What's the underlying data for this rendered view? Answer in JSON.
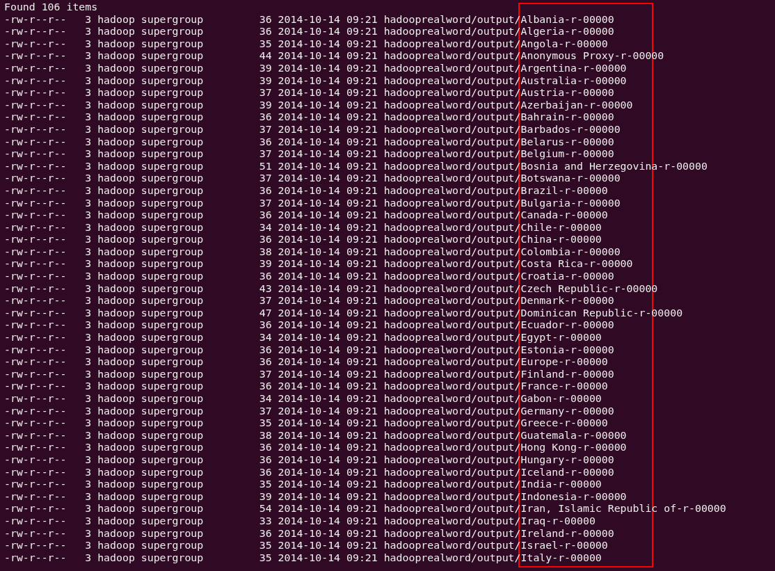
{
  "terminal": {
    "header_line": "Found 106 items",
    "entries": [
      {
        "permissions": "-rw-r--r--",
        "replication": "3",
        "owner": "hadoop",
        "group": "supergroup",
        "size": "36",
        "date": "2014-10-14",
        "time": "09:21",
        "directory": "hadooprealword/output/",
        "file": "Albania-r-00000"
      },
      {
        "permissions": "-rw-r--r--",
        "replication": "3",
        "owner": "hadoop",
        "group": "supergroup",
        "size": "36",
        "date": "2014-10-14",
        "time": "09:21",
        "directory": "hadooprealword/output/",
        "file": "Algeria-r-00000"
      },
      {
        "permissions": "-rw-r--r--",
        "replication": "3",
        "owner": "hadoop",
        "group": "supergroup",
        "size": "35",
        "date": "2014-10-14",
        "time": "09:21",
        "directory": "hadooprealword/output/",
        "file": "Angola-r-00000"
      },
      {
        "permissions": "-rw-r--r--",
        "replication": "3",
        "owner": "hadoop",
        "group": "supergroup",
        "size": "44",
        "date": "2014-10-14",
        "time": "09:21",
        "directory": "hadooprealword/output/",
        "file": "Anonymous Proxy-r-00000"
      },
      {
        "permissions": "-rw-r--r--",
        "replication": "3",
        "owner": "hadoop",
        "group": "supergroup",
        "size": "39",
        "date": "2014-10-14",
        "time": "09:21",
        "directory": "hadooprealword/output/",
        "file": "Argentina-r-00000"
      },
      {
        "permissions": "-rw-r--r--",
        "replication": "3",
        "owner": "hadoop",
        "group": "supergroup",
        "size": "39",
        "date": "2014-10-14",
        "time": "09:21",
        "directory": "hadooprealword/output/",
        "file": "Australia-r-00000"
      },
      {
        "permissions": "-rw-r--r--",
        "replication": "3",
        "owner": "hadoop",
        "group": "supergroup",
        "size": "37",
        "date": "2014-10-14",
        "time": "09:21",
        "directory": "hadooprealword/output/",
        "file": "Austria-r-00000"
      },
      {
        "permissions": "-rw-r--r--",
        "replication": "3",
        "owner": "hadoop",
        "group": "supergroup",
        "size": "39",
        "date": "2014-10-14",
        "time": "09:21",
        "directory": "hadooprealword/output/",
        "file": "Azerbaijan-r-00000"
      },
      {
        "permissions": "-rw-r--r--",
        "replication": "3",
        "owner": "hadoop",
        "group": "supergroup",
        "size": "36",
        "date": "2014-10-14",
        "time": "09:21",
        "directory": "hadooprealword/output/",
        "file": "Bahrain-r-00000"
      },
      {
        "permissions": "-rw-r--r--",
        "replication": "3",
        "owner": "hadoop",
        "group": "supergroup",
        "size": "37",
        "date": "2014-10-14",
        "time": "09:21",
        "directory": "hadooprealword/output/",
        "file": "Barbados-r-00000"
      },
      {
        "permissions": "-rw-r--r--",
        "replication": "3",
        "owner": "hadoop",
        "group": "supergroup",
        "size": "36",
        "date": "2014-10-14",
        "time": "09:21",
        "directory": "hadooprealword/output/",
        "file": "Belarus-r-00000"
      },
      {
        "permissions": "-rw-r--r--",
        "replication": "3",
        "owner": "hadoop",
        "group": "supergroup",
        "size": "37",
        "date": "2014-10-14",
        "time": "09:21",
        "directory": "hadooprealword/output/",
        "file": "Belgium-r-00000"
      },
      {
        "permissions": "-rw-r--r--",
        "replication": "3",
        "owner": "hadoop",
        "group": "supergroup",
        "size": "51",
        "date": "2014-10-14",
        "time": "09:21",
        "directory": "hadooprealword/output/",
        "file": "Bosnia and Herzegovina-r-00000"
      },
      {
        "permissions": "-rw-r--r--",
        "replication": "3",
        "owner": "hadoop",
        "group": "supergroup",
        "size": "37",
        "date": "2014-10-14",
        "time": "09:21",
        "directory": "hadooprealword/output/",
        "file": "Botswana-r-00000"
      },
      {
        "permissions": "-rw-r--r--",
        "replication": "3",
        "owner": "hadoop",
        "group": "supergroup",
        "size": "36",
        "date": "2014-10-14",
        "time": "09:21",
        "directory": "hadooprealword/output/",
        "file": "Brazil-r-00000"
      },
      {
        "permissions": "-rw-r--r--",
        "replication": "3",
        "owner": "hadoop",
        "group": "supergroup",
        "size": "37",
        "date": "2014-10-14",
        "time": "09:21",
        "directory": "hadooprealword/output/",
        "file": "Bulgaria-r-00000"
      },
      {
        "permissions": "-rw-r--r--",
        "replication": "3",
        "owner": "hadoop",
        "group": "supergroup",
        "size": "36",
        "date": "2014-10-14",
        "time": "09:21",
        "directory": "hadooprealword/output/",
        "file": "Canada-r-00000"
      },
      {
        "permissions": "-rw-r--r--",
        "replication": "3",
        "owner": "hadoop",
        "group": "supergroup",
        "size": "34",
        "date": "2014-10-14",
        "time": "09:21",
        "directory": "hadooprealword/output/",
        "file": "Chile-r-00000"
      },
      {
        "permissions": "-rw-r--r--",
        "replication": "3",
        "owner": "hadoop",
        "group": "supergroup",
        "size": "36",
        "date": "2014-10-14",
        "time": "09:21",
        "directory": "hadooprealword/output/",
        "file": "China-r-00000"
      },
      {
        "permissions": "-rw-r--r--",
        "replication": "3",
        "owner": "hadoop",
        "group": "supergroup",
        "size": "38",
        "date": "2014-10-14",
        "time": "09:21",
        "directory": "hadooprealword/output/",
        "file": "Colombia-r-00000"
      },
      {
        "permissions": "-rw-r--r--",
        "replication": "3",
        "owner": "hadoop",
        "group": "supergroup",
        "size": "39",
        "date": "2014-10-14",
        "time": "09:21",
        "directory": "hadooprealword/output/",
        "file": "Costa Rica-r-00000"
      },
      {
        "permissions": "-rw-r--r--",
        "replication": "3",
        "owner": "hadoop",
        "group": "supergroup",
        "size": "36",
        "date": "2014-10-14",
        "time": "09:21",
        "directory": "hadooprealword/output/",
        "file": "Croatia-r-00000"
      },
      {
        "permissions": "-rw-r--r--",
        "replication": "3",
        "owner": "hadoop",
        "group": "supergroup",
        "size": "43",
        "date": "2014-10-14",
        "time": "09:21",
        "directory": "hadooprealword/output/",
        "file": "Czech Republic-r-00000"
      },
      {
        "permissions": "-rw-r--r--",
        "replication": "3",
        "owner": "hadoop",
        "group": "supergroup",
        "size": "37",
        "date": "2014-10-14",
        "time": "09:21",
        "directory": "hadooprealword/output/",
        "file": "Denmark-r-00000"
      },
      {
        "permissions": "-rw-r--r--",
        "replication": "3",
        "owner": "hadoop",
        "group": "supergroup",
        "size": "47",
        "date": "2014-10-14",
        "time": "09:21",
        "directory": "hadooprealword/output/",
        "file": "Dominican Republic-r-00000"
      },
      {
        "permissions": "-rw-r--r--",
        "replication": "3",
        "owner": "hadoop",
        "group": "supergroup",
        "size": "36",
        "date": "2014-10-14",
        "time": "09:21",
        "directory": "hadooprealword/output/",
        "file": "Ecuador-r-00000"
      },
      {
        "permissions": "-rw-r--r--",
        "replication": "3",
        "owner": "hadoop",
        "group": "supergroup",
        "size": "34",
        "date": "2014-10-14",
        "time": "09:21",
        "directory": "hadooprealword/output/",
        "file": "Egypt-r-00000"
      },
      {
        "permissions": "-rw-r--r--",
        "replication": "3",
        "owner": "hadoop",
        "group": "supergroup",
        "size": "36",
        "date": "2014-10-14",
        "time": "09:21",
        "directory": "hadooprealword/output/",
        "file": "Estonia-r-00000"
      },
      {
        "permissions": "-rw-r--r--",
        "replication": "3",
        "owner": "hadoop",
        "group": "supergroup",
        "size": "36",
        "date": "2014-10-14",
        "time": "09:21",
        "directory": "hadooprealword/output/",
        "file": "Europe-r-00000"
      },
      {
        "permissions": "-rw-r--r--",
        "replication": "3",
        "owner": "hadoop",
        "group": "supergroup",
        "size": "37",
        "date": "2014-10-14",
        "time": "09:21",
        "directory": "hadooprealword/output/",
        "file": "Finland-r-00000"
      },
      {
        "permissions": "-rw-r--r--",
        "replication": "3",
        "owner": "hadoop",
        "group": "supergroup",
        "size": "36",
        "date": "2014-10-14",
        "time": "09:21",
        "directory": "hadooprealword/output/",
        "file": "France-r-00000"
      },
      {
        "permissions": "-rw-r--r--",
        "replication": "3",
        "owner": "hadoop",
        "group": "supergroup",
        "size": "34",
        "date": "2014-10-14",
        "time": "09:21",
        "directory": "hadooprealword/output/",
        "file": "Gabon-r-00000"
      },
      {
        "permissions": "-rw-r--r--",
        "replication": "3",
        "owner": "hadoop",
        "group": "supergroup",
        "size": "37",
        "date": "2014-10-14",
        "time": "09:21",
        "directory": "hadooprealword/output/",
        "file": "Germany-r-00000"
      },
      {
        "permissions": "-rw-r--r--",
        "replication": "3",
        "owner": "hadoop",
        "group": "supergroup",
        "size": "35",
        "date": "2014-10-14",
        "time": "09:21",
        "directory": "hadooprealword/output/",
        "file": "Greece-r-00000"
      },
      {
        "permissions": "-rw-r--r--",
        "replication": "3",
        "owner": "hadoop",
        "group": "supergroup",
        "size": "38",
        "date": "2014-10-14",
        "time": "09:21",
        "directory": "hadooprealword/output/",
        "file": "Guatemala-r-00000"
      },
      {
        "permissions": "-rw-r--r--",
        "replication": "3",
        "owner": "hadoop",
        "group": "supergroup",
        "size": "36",
        "date": "2014-10-14",
        "time": "09:21",
        "directory": "hadooprealword/output/",
        "file": "Hong Kong-r-00000"
      },
      {
        "permissions": "-rw-r--r--",
        "replication": "3",
        "owner": "hadoop",
        "group": "supergroup",
        "size": "36",
        "date": "2014-10-14",
        "time": "09:21",
        "directory": "hadooprealword/output/",
        "file": "Hungary-r-00000"
      },
      {
        "permissions": "-rw-r--r--",
        "replication": "3",
        "owner": "hadoop",
        "group": "supergroup",
        "size": "36",
        "date": "2014-10-14",
        "time": "09:21",
        "directory": "hadooprealword/output/",
        "file": "Iceland-r-00000"
      },
      {
        "permissions": "-rw-r--r--",
        "replication": "3",
        "owner": "hadoop",
        "group": "supergroup",
        "size": "35",
        "date": "2014-10-14",
        "time": "09:21",
        "directory": "hadooprealword/output/",
        "file": "India-r-00000"
      },
      {
        "permissions": "-rw-r--r--",
        "replication": "3",
        "owner": "hadoop",
        "group": "supergroup",
        "size": "39",
        "date": "2014-10-14",
        "time": "09:21",
        "directory": "hadooprealword/output/",
        "file": "Indonesia-r-00000"
      },
      {
        "permissions": "-rw-r--r--",
        "replication": "3",
        "owner": "hadoop",
        "group": "supergroup",
        "size": "54",
        "date": "2014-10-14",
        "time": "09:21",
        "directory": "hadooprealword/output/",
        "file": "Iran, Islamic Republic of-r-00000"
      },
      {
        "permissions": "-rw-r--r--",
        "replication": "3",
        "owner": "hadoop",
        "group": "supergroup",
        "size": "33",
        "date": "2014-10-14",
        "time": "09:21",
        "directory": "hadooprealword/output/",
        "file": "Iraq-r-00000"
      },
      {
        "permissions": "-rw-r--r--",
        "replication": "3",
        "owner": "hadoop",
        "group": "supergroup",
        "size": "36",
        "date": "2014-10-14",
        "time": "09:21",
        "directory": "hadooprealword/output/",
        "file": "Ireland-r-00000"
      },
      {
        "permissions": "-rw-r--r--",
        "replication": "3",
        "owner": "hadoop",
        "group": "supergroup",
        "size": "35",
        "date": "2014-10-14",
        "time": "09:21",
        "directory": "hadooprealword/output/",
        "file": "Israel-r-00000"
      },
      {
        "permissions": "-rw-r--r--",
        "replication": "3",
        "owner": "hadoop",
        "group": "supergroup",
        "size": "35",
        "date": "2014-10-14",
        "time": "09:21",
        "directory": "hadooprealword/output/",
        "file": "Italy-r-00000"
      }
    ]
  }
}
